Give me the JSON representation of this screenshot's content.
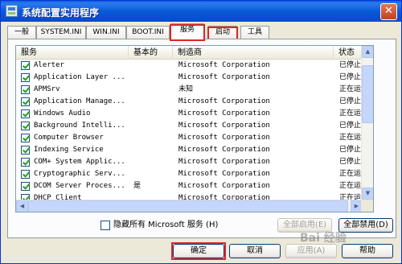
{
  "window": {
    "title": "系统配置实用程序",
    "close_symbol": "✕"
  },
  "tabs": [
    {
      "label": "一般"
    },
    {
      "label": "SYSTEM.INI"
    },
    {
      "label": "WIN.INI"
    },
    {
      "label": "BOOT.INI"
    },
    {
      "label": "服务",
      "active": true,
      "highlighted": true
    },
    {
      "label": "启动",
      "highlighted": true
    },
    {
      "label": "工具"
    }
  ],
  "list": {
    "columns": [
      "服务",
      "基本的",
      "制造商",
      "状态"
    ],
    "rows": [
      {
        "name": "Alerter",
        "basic": "",
        "maker": "Microsoft Corporation",
        "status": "已停止",
        "checked": true
      },
      {
        "name": "Application Layer ...",
        "basic": "",
        "maker": "Microsoft Corporation",
        "status": "已停止",
        "checked": true
      },
      {
        "name": "APMSrv",
        "basic": "",
        "maker": "未知",
        "status": "正在运行",
        "checked": true
      },
      {
        "name": "Application Manage...",
        "basic": "",
        "maker": "Microsoft Corporation",
        "status": "已停止",
        "checked": true
      },
      {
        "name": "Windows Audio",
        "basic": "",
        "maker": "Microsoft Corporation",
        "status": "正在运行",
        "checked": true
      },
      {
        "name": "Background Intelli...",
        "basic": "",
        "maker": "Microsoft Corporation",
        "status": "已停止",
        "checked": true
      },
      {
        "name": "Computer Browser",
        "basic": "",
        "maker": "Microsoft Corporation",
        "status": "正在运行",
        "checked": true
      },
      {
        "name": "Indexing Service",
        "basic": "",
        "maker": "Microsoft Corporation",
        "status": "已停止",
        "checked": true
      },
      {
        "name": "COM+ System Applic...",
        "basic": "",
        "maker": "Microsoft Corporation",
        "status": "已停止",
        "checked": true
      },
      {
        "name": "Cryptographic Serv...",
        "basic": "",
        "maker": "Microsoft Corporation",
        "status": "正在运行",
        "checked": true
      },
      {
        "name": "DCOM Server Proces...",
        "basic": "是",
        "maker": "Microsoft Corporation",
        "status": "正在运行",
        "checked": true
      },
      {
        "name": "DHCP Client",
        "basic": "",
        "maker": "Microsoft Corporation",
        "status": "正在运行",
        "checked": true
      }
    ]
  },
  "hide_ms": {
    "label": "隐藏所有 Microsoft 服务 (H)",
    "checked": false
  },
  "buttons": {
    "enable_all": "全部启用(E)",
    "disable_all": "全部禁用(D)",
    "ok": "确定",
    "cancel": "取消",
    "apply": "应用(A)",
    "help": "帮助"
  },
  "watermark": "Bai 经验"
}
